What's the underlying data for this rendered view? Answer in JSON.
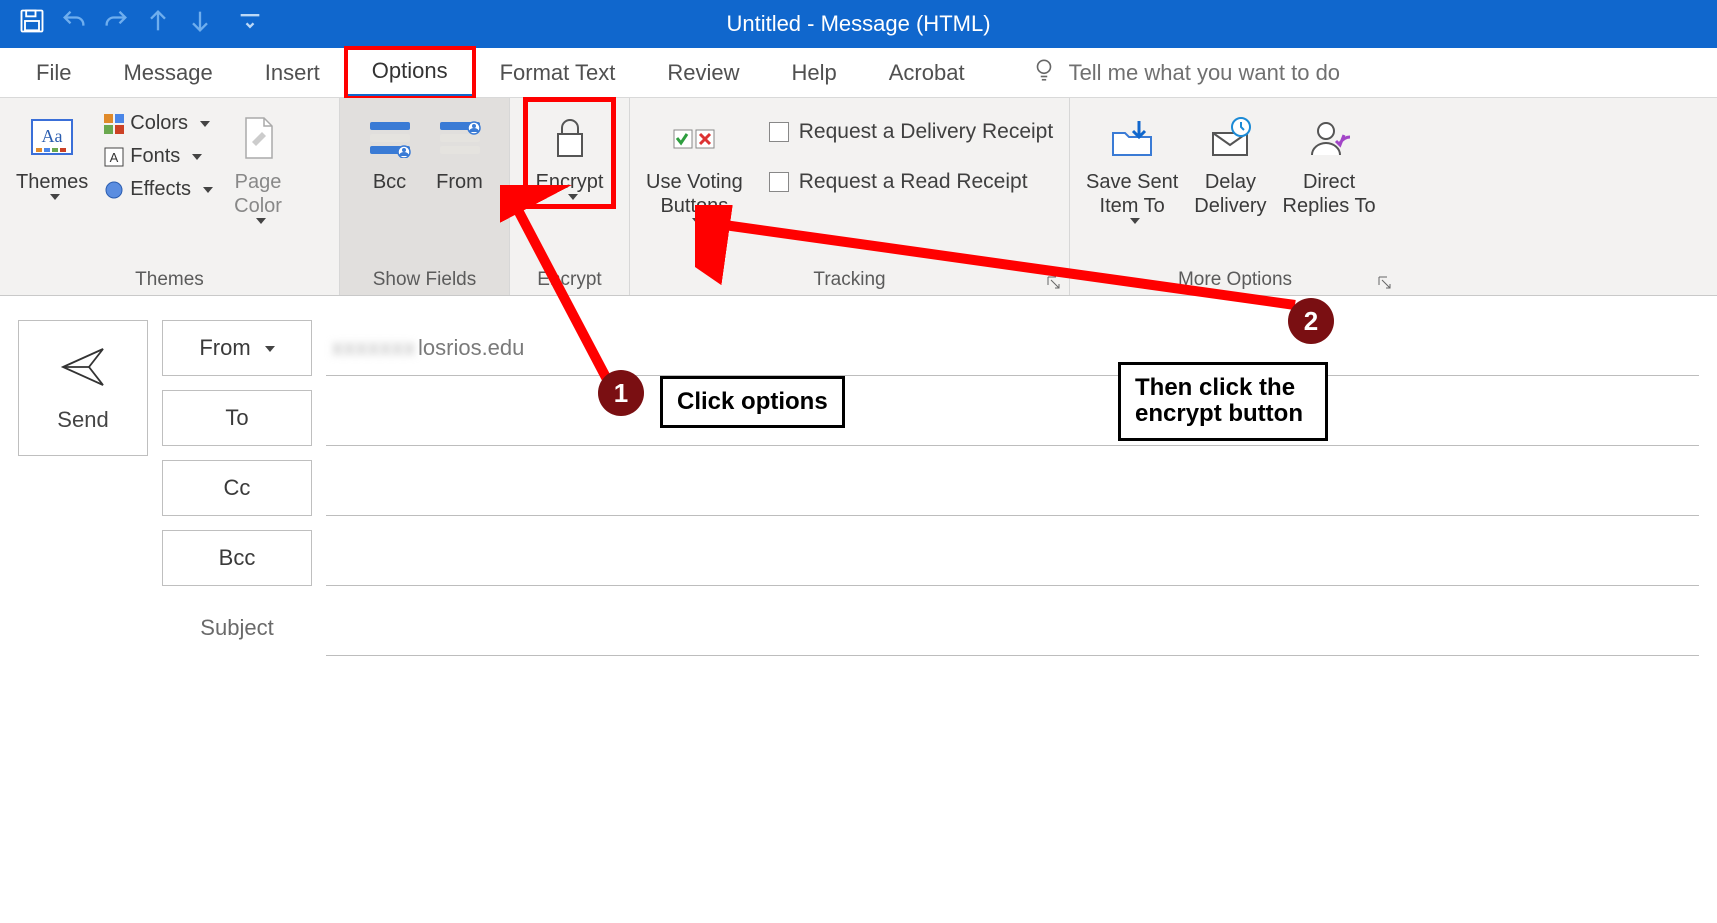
{
  "titlebar": {
    "title": "Untitled  -  Message (HTML)"
  },
  "tabs": {
    "file": "File",
    "message": "Message",
    "insert": "Insert",
    "options": "Options",
    "format_text": "Format Text",
    "review": "Review",
    "help": "Help",
    "acrobat": "Acrobat",
    "tell_me": "Tell me what you want to do"
  },
  "ribbon": {
    "themes": {
      "themes_label": "Themes",
      "colors": "Colors",
      "fonts": "Fonts",
      "effects": "Effects",
      "page_color": "Page",
      "page_color2": "Color",
      "group_label": "Themes"
    },
    "show_fields": {
      "bcc": "Bcc",
      "from": "From",
      "group_label": "Show Fields"
    },
    "encrypt": {
      "encrypt": "Encrypt",
      "group_label": "Encrypt"
    },
    "tracking": {
      "use_voting": "Use Voting",
      "buttons": "Buttons",
      "delivery_receipt": "Request a Delivery Receipt",
      "read_receipt": "Request a Read Receipt",
      "group_label": "Tracking"
    },
    "more_options": {
      "save_sent1": "Save Sent",
      "save_sent2": "Item To",
      "delay1": "Delay",
      "delay2": "Delivery",
      "direct1": "Direct",
      "direct2": "Replies To",
      "group_label": "More Options"
    }
  },
  "compose": {
    "send": "Send",
    "from": "From",
    "to": "To",
    "cc": "Cc",
    "bcc": "Bcc",
    "subject": "Subject",
    "from_value_visible": "losrios.edu",
    "from_value_blurred": "xxxxxxx"
  },
  "annotations": {
    "step1": "1",
    "step2": "2",
    "callout1": "Click options",
    "callout2_line1": "Then click the",
    "callout2_line2": "encrypt button"
  }
}
